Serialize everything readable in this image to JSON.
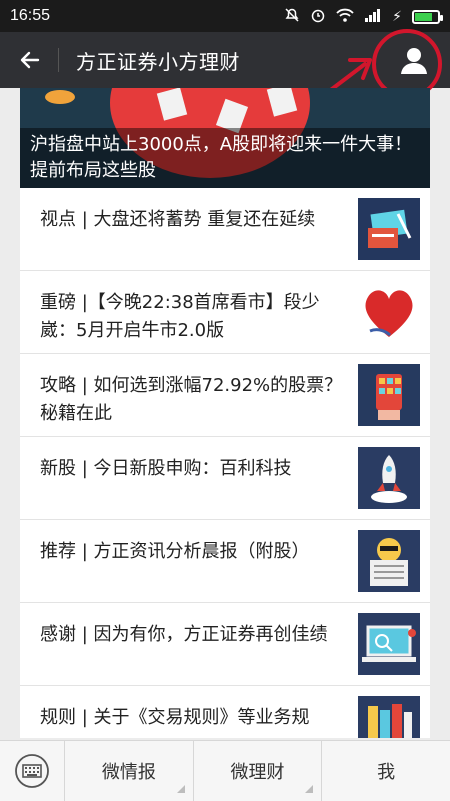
{
  "status": {
    "time": "16:55"
  },
  "header": {
    "title": "方正证券小方理财"
  },
  "banner": {
    "caption": "沪指盘中站上3000点，A股即将迎来一件大事！提前布局这些股"
  },
  "articles": [
    {
      "text": "视点 | 大盘还将蓄势  重复还在延续",
      "icon": "card-icon"
    },
    {
      "text": "重磅 |【今晚22:38首席看市】段少崴：5月开启牛市2.0版",
      "icon": "heart-icon"
    },
    {
      "text": "攻略 | 如何选到涨幅72.92%的股票？秘籍在此",
      "icon": "hand-icon"
    },
    {
      "text": "新股 | 今日新股申购：百利科技",
      "icon": "rocket-icon"
    },
    {
      "text": "推荐 | 方正资讯分析晨报（附股）",
      "icon": "newspaper-icon"
    },
    {
      "text": "感谢 | 因为有你，方正证券再创佳绩",
      "icon": "laptop-icon"
    },
    {
      "text": "规则 | 关于《交易规则》等业务规",
      "icon": "books-icon"
    }
  ],
  "bottom_nav": {
    "tabs": [
      {
        "label": "微情报"
      },
      {
        "label": "微理财"
      },
      {
        "label": "我"
      }
    ]
  }
}
